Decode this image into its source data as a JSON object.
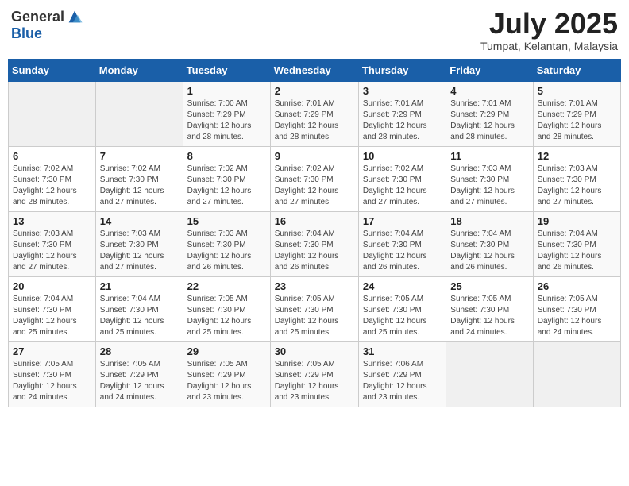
{
  "logo": {
    "general": "General",
    "blue": "Blue"
  },
  "title": "July 2025",
  "location": "Tumpat, Kelantan, Malaysia",
  "days_of_week": [
    "Sunday",
    "Monday",
    "Tuesday",
    "Wednesday",
    "Thursday",
    "Friday",
    "Saturday"
  ],
  "weeks": [
    [
      {
        "day": "",
        "info": ""
      },
      {
        "day": "",
        "info": ""
      },
      {
        "day": "1",
        "info": "Sunrise: 7:00 AM\nSunset: 7:29 PM\nDaylight: 12 hours\nand 28 minutes."
      },
      {
        "day": "2",
        "info": "Sunrise: 7:01 AM\nSunset: 7:29 PM\nDaylight: 12 hours\nand 28 minutes."
      },
      {
        "day": "3",
        "info": "Sunrise: 7:01 AM\nSunset: 7:29 PM\nDaylight: 12 hours\nand 28 minutes."
      },
      {
        "day": "4",
        "info": "Sunrise: 7:01 AM\nSunset: 7:29 PM\nDaylight: 12 hours\nand 28 minutes."
      },
      {
        "day": "5",
        "info": "Sunrise: 7:01 AM\nSunset: 7:29 PM\nDaylight: 12 hours\nand 28 minutes."
      }
    ],
    [
      {
        "day": "6",
        "info": "Sunrise: 7:02 AM\nSunset: 7:30 PM\nDaylight: 12 hours\nand 28 minutes."
      },
      {
        "day": "7",
        "info": "Sunrise: 7:02 AM\nSunset: 7:30 PM\nDaylight: 12 hours\nand 27 minutes."
      },
      {
        "day": "8",
        "info": "Sunrise: 7:02 AM\nSunset: 7:30 PM\nDaylight: 12 hours\nand 27 minutes."
      },
      {
        "day": "9",
        "info": "Sunrise: 7:02 AM\nSunset: 7:30 PM\nDaylight: 12 hours\nand 27 minutes."
      },
      {
        "day": "10",
        "info": "Sunrise: 7:02 AM\nSunset: 7:30 PM\nDaylight: 12 hours\nand 27 minutes."
      },
      {
        "day": "11",
        "info": "Sunrise: 7:03 AM\nSunset: 7:30 PM\nDaylight: 12 hours\nand 27 minutes."
      },
      {
        "day": "12",
        "info": "Sunrise: 7:03 AM\nSunset: 7:30 PM\nDaylight: 12 hours\nand 27 minutes."
      }
    ],
    [
      {
        "day": "13",
        "info": "Sunrise: 7:03 AM\nSunset: 7:30 PM\nDaylight: 12 hours\nand 27 minutes."
      },
      {
        "day": "14",
        "info": "Sunrise: 7:03 AM\nSunset: 7:30 PM\nDaylight: 12 hours\nand 27 minutes."
      },
      {
        "day": "15",
        "info": "Sunrise: 7:03 AM\nSunset: 7:30 PM\nDaylight: 12 hours\nand 26 minutes."
      },
      {
        "day": "16",
        "info": "Sunrise: 7:04 AM\nSunset: 7:30 PM\nDaylight: 12 hours\nand 26 minutes."
      },
      {
        "day": "17",
        "info": "Sunrise: 7:04 AM\nSunset: 7:30 PM\nDaylight: 12 hours\nand 26 minutes."
      },
      {
        "day": "18",
        "info": "Sunrise: 7:04 AM\nSunset: 7:30 PM\nDaylight: 12 hours\nand 26 minutes."
      },
      {
        "day": "19",
        "info": "Sunrise: 7:04 AM\nSunset: 7:30 PM\nDaylight: 12 hours\nand 26 minutes."
      }
    ],
    [
      {
        "day": "20",
        "info": "Sunrise: 7:04 AM\nSunset: 7:30 PM\nDaylight: 12 hours\nand 25 minutes."
      },
      {
        "day": "21",
        "info": "Sunrise: 7:04 AM\nSunset: 7:30 PM\nDaylight: 12 hours\nand 25 minutes."
      },
      {
        "day": "22",
        "info": "Sunrise: 7:05 AM\nSunset: 7:30 PM\nDaylight: 12 hours\nand 25 minutes."
      },
      {
        "day": "23",
        "info": "Sunrise: 7:05 AM\nSunset: 7:30 PM\nDaylight: 12 hours\nand 25 minutes."
      },
      {
        "day": "24",
        "info": "Sunrise: 7:05 AM\nSunset: 7:30 PM\nDaylight: 12 hours\nand 25 minutes."
      },
      {
        "day": "25",
        "info": "Sunrise: 7:05 AM\nSunset: 7:30 PM\nDaylight: 12 hours\nand 24 minutes."
      },
      {
        "day": "26",
        "info": "Sunrise: 7:05 AM\nSunset: 7:30 PM\nDaylight: 12 hours\nand 24 minutes."
      }
    ],
    [
      {
        "day": "27",
        "info": "Sunrise: 7:05 AM\nSunset: 7:30 PM\nDaylight: 12 hours\nand 24 minutes."
      },
      {
        "day": "28",
        "info": "Sunrise: 7:05 AM\nSunset: 7:29 PM\nDaylight: 12 hours\nand 24 minutes."
      },
      {
        "day": "29",
        "info": "Sunrise: 7:05 AM\nSunset: 7:29 PM\nDaylight: 12 hours\nand 23 minutes."
      },
      {
        "day": "30",
        "info": "Sunrise: 7:05 AM\nSunset: 7:29 PM\nDaylight: 12 hours\nand 23 minutes."
      },
      {
        "day": "31",
        "info": "Sunrise: 7:06 AM\nSunset: 7:29 PM\nDaylight: 12 hours\nand 23 minutes."
      },
      {
        "day": "",
        "info": ""
      },
      {
        "day": "",
        "info": ""
      }
    ]
  ]
}
